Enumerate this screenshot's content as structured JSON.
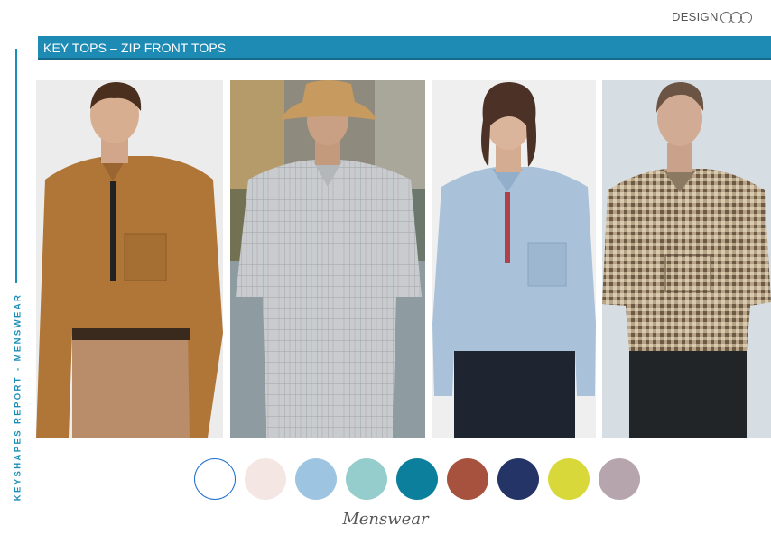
{
  "header": {
    "brand_text": "DESIGN",
    "brand_mark": "pool-rings-logo"
  },
  "sidebar": {
    "vertical_label": "KEYSHAPES REPORT - MENSWEAR"
  },
  "title_bar": {
    "title": "KEY TOPS – ZIP FRONT TOPS"
  },
  "photos": [
    {
      "subject": "tan zip-front long sleeve shirt"
    },
    {
      "subject": "grey check short sleeve zip top with bucket hat"
    },
    {
      "subject": "light blue zip-front long sleeve top"
    },
    {
      "subject": "brown check short sleeve zip shirt"
    }
  ],
  "palette": {
    "swatches": [
      "#ffffff",
      "#f4e6e2",
      "#9dc4e0",
      "#94cdcb",
      "#0b7f9b",
      "#a7523e",
      "#243466",
      "#d9d83b",
      "#b6a5ad"
    ],
    "outlined_index": 0,
    "outline_color": "#1e6fd0"
  },
  "caption": {
    "text": "Menswear"
  },
  "colors": {
    "accent": "#1e8bb5",
    "accent_dark": "#15698a",
    "text_muted": "#555555"
  }
}
